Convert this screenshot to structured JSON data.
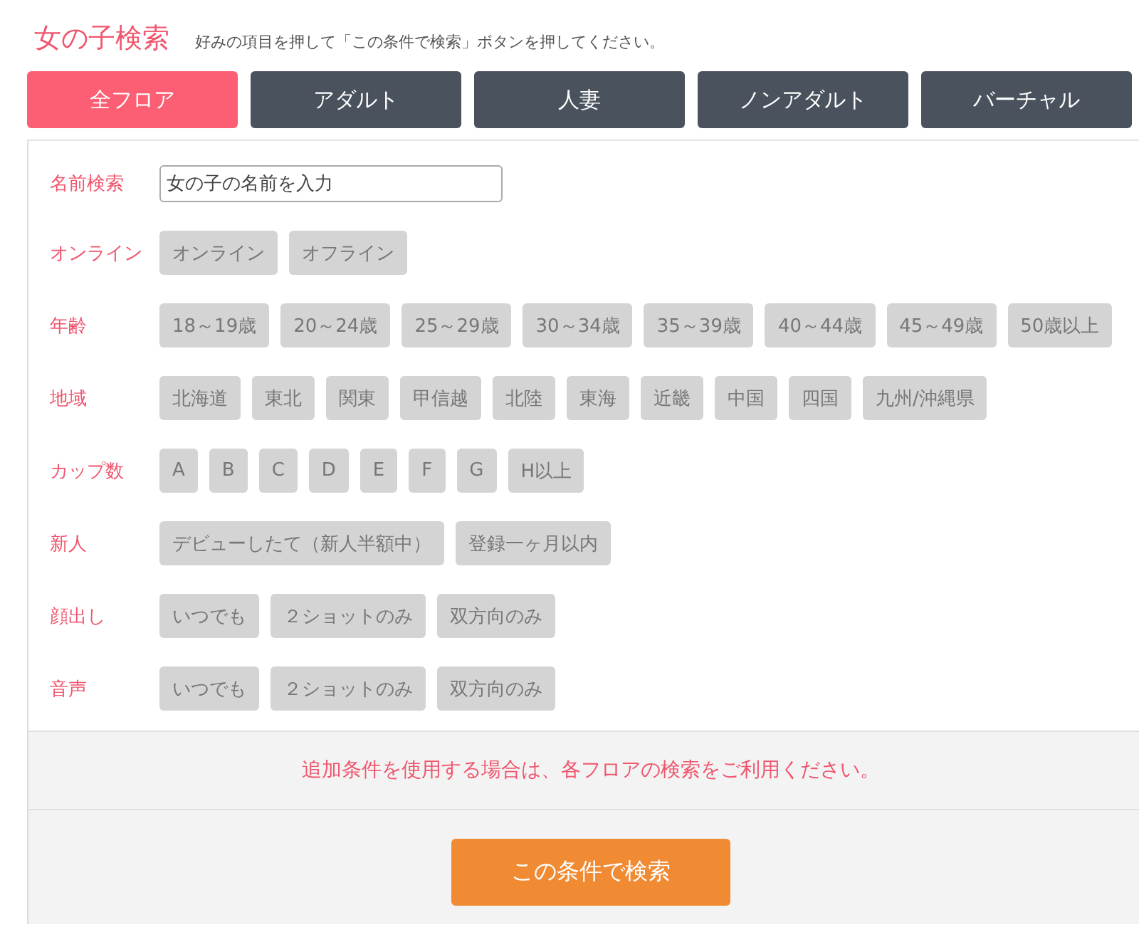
{
  "title": "女の子検索",
  "subtitle": "好みの項目を押して「この条件で検索」ボタンを押してください。",
  "tabs": [
    {
      "label": "全フロア",
      "selected": true
    },
    {
      "label": "アダルト",
      "selected": false
    },
    {
      "label": "人妻",
      "selected": false
    },
    {
      "label": "ノンアダルト",
      "selected": false
    },
    {
      "label": "バーチャル",
      "selected": false
    }
  ],
  "name_search": {
    "label": "名前検索",
    "placeholder": "女の子の名前を入力"
  },
  "filters": [
    {
      "label": "オンライン",
      "options": [
        "オンライン",
        "オフライン"
      ]
    },
    {
      "label": "年齢",
      "options": [
        "18～19歳",
        "20～24歳",
        "25～29歳",
        "30～34歳",
        "35～39歳",
        "40～44歳",
        "45～49歳",
        "50歳以上"
      ]
    },
    {
      "label": "地域",
      "options": [
        "北海道",
        "東北",
        "関東",
        "甲信越",
        "北陸",
        "東海",
        "近畿",
        "中国",
        "四国",
        "九州/沖縄県"
      ]
    },
    {
      "label": "カップ数",
      "options": [
        "A",
        "B",
        "C",
        "D",
        "E",
        "F",
        "G",
        "H以上"
      ]
    },
    {
      "label": "新人",
      "options": [
        "デビューしたて（新人半額中）",
        "登録一ヶ月以内"
      ]
    },
    {
      "label": "顔出し",
      "options": [
        "いつでも",
        "２ショットのみ",
        "双方向のみ"
      ]
    },
    {
      "label": "音声",
      "options": [
        "いつでも",
        "２ショットのみ",
        "双方向のみ"
      ]
    }
  ],
  "notice": "追加条件を使用する場合は、各フロアの検索をご利用ください。",
  "search_button": "この条件で検索"
}
